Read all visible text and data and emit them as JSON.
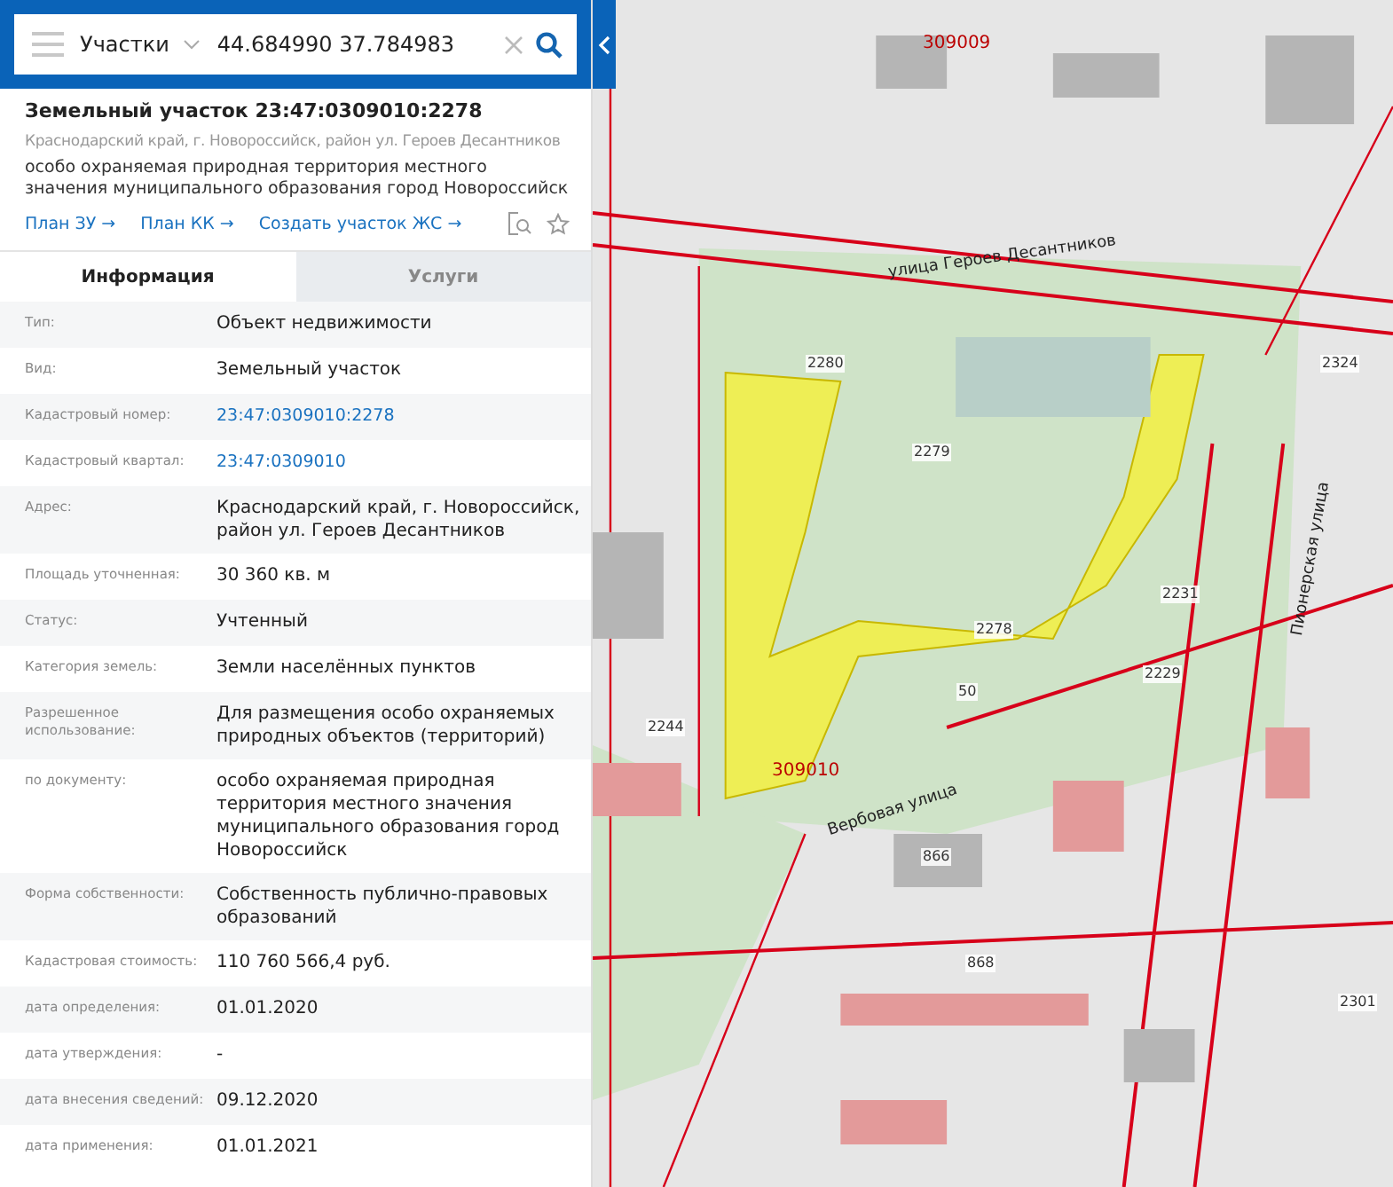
{
  "search": {
    "layer": "Участки",
    "query": "44.684990 37.784983"
  },
  "object": {
    "title": "Земельный участок 23:47:0309010:2278",
    "address": "Краснодарский край, г. Новороссийск, район ул. Героев Десантников",
    "description": "особо охраняемая природная территория местного значения муниципального образования город Новороссийск",
    "links": [
      "План ЗУ →",
      "План КК →",
      "Создать участок ЖС →"
    ]
  },
  "tabs": [
    {
      "label": "Информация",
      "selected": true
    },
    {
      "label": "Услуги",
      "selected": false
    }
  ],
  "rows": [
    {
      "label": "Тип:",
      "value": "Объект недвижимости",
      "kind": "text"
    },
    {
      "label": "Вид:",
      "value": "Земельный участок",
      "kind": "text"
    },
    {
      "label": "Кадастровый номер:",
      "value": "23:47:0309010:2278",
      "kind": "link"
    },
    {
      "label": "Кадастровый квартал:",
      "value": "23:47:0309010",
      "kind": "link"
    },
    {
      "label": "Адрес:",
      "value": "Краснодарский край, г. Новороссийск, район ул. Героев Десантников",
      "kind": "text"
    },
    {
      "label": "Площадь уточненная:",
      "value": "30 360 кв. м",
      "kind": "text"
    },
    {
      "label": "Статус:",
      "value": "Учтенный",
      "kind": "text"
    },
    {
      "label": "Категория земель:",
      "value": "Земли населённых пунктов",
      "kind": "text"
    },
    {
      "label": "Разрешенное использование:",
      "value": "Для размещения особо охраняемых природных объектов (территорий)",
      "kind": "text"
    },
    {
      "label": "по документу:",
      "value": "особо охраняемая природная территория местного значения муниципального образования город Новороссийск",
      "kind": "text"
    },
    {
      "label": "Форма собственности:",
      "value": "Собственность публично-правовых образований",
      "kind": "text"
    },
    {
      "label": "Кадастровая стоимость:",
      "value": "110 760 566,4 руб.",
      "kind": "text"
    },
    {
      "label": "дата определения:",
      "value": "01.01.2020",
      "kind": "text"
    },
    {
      "label": "дата утверждения:",
      "value": "-",
      "kind": "text"
    },
    {
      "label": "дата внесения сведений:",
      "value": "09.12.2020",
      "kind": "text"
    },
    {
      "label": "дата применения:",
      "value": "01.01.2021",
      "kind": "text"
    }
  ],
  "map": {
    "labels": [
      {
        "text": "улица Героев Десантников",
        "kind": "street"
      },
      {
        "text": "Вербовая улица",
        "kind": "street"
      },
      {
        "text": "Пионерская улица",
        "kind": "street"
      },
      {
        "text": "309009",
        "kind": "quarter"
      },
      {
        "text": "309010",
        "kind": "quarter"
      },
      {
        "text": "2278",
        "kind": "parcel"
      },
      {
        "text": "2280",
        "kind": "parcel"
      },
      {
        "text": "2279",
        "kind": "parcel"
      },
      {
        "text": "2231",
        "kind": "parcel"
      },
      {
        "text": "2229",
        "kind": "parcel"
      },
      {
        "text": "2324",
        "kind": "parcel"
      },
      {
        "text": "50",
        "kind": "parcel"
      },
      {
        "text": "866",
        "kind": "parcel"
      },
      {
        "text": "868",
        "kind": "parcel"
      },
      {
        "text": "2301",
        "kind": "parcel"
      },
      {
        "text": "2244",
        "kind": "parcel"
      }
    ]
  }
}
